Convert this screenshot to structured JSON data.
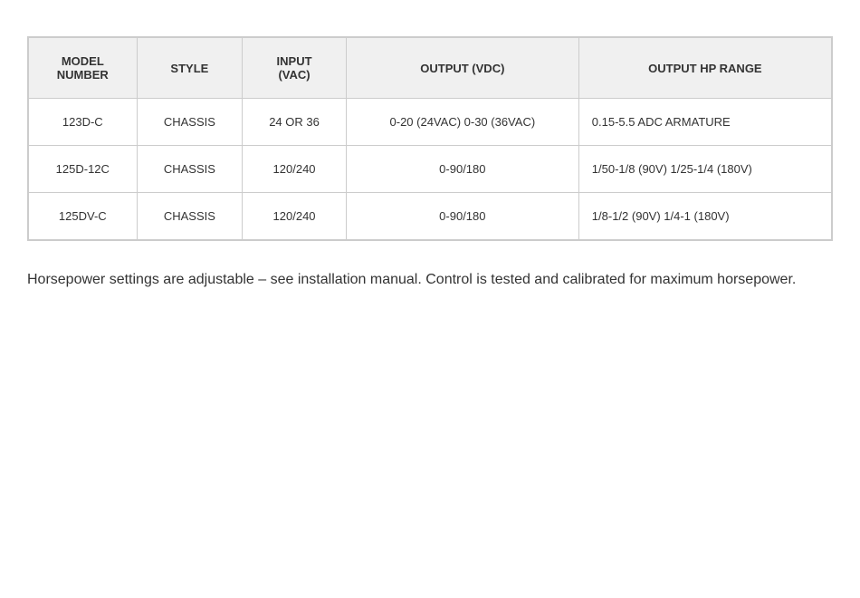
{
  "table": {
    "headers": [
      {
        "id": "model-number",
        "label": "MODEL\nNUMBER"
      },
      {
        "id": "style",
        "label": "STYLE"
      },
      {
        "id": "input-vac",
        "label": "INPUT\n(VAC)"
      },
      {
        "id": "output-vdc",
        "label": "OUTPUT (VDC)"
      },
      {
        "id": "output-hp-range",
        "label": "OUTPUT HP RANGE"
      }
    ],
    "rows": [
      {
        "model": "123D-C",
        "style": "CHASSIS",
        "input": "24 OR 36",
        "output_vdc": "0-20 (24VAC) 0-30 (36VAC)",
        "output_hp": "0.15-5.5 ADC ARMATURE"
      },
      {
        "model": "125D-12C",
        "style": "CHASSIS",
        "input": "120/240",
        "output_vdc": "0-90/180",
        "output_hp": "1/50-1/8 (90V) 1/25-1/4 (180V)"
      },
      {
        "model": "125DV-C",
        "style": "CHASSIS",
        "input": "120/240",
        "output_vdc": "0-90/180",
        "output_hp": "1/8-1/2 (90V) 1/4-1 (180V)"
      }
    ]
  },
  "footer": {
    "text": "Horsepower settings are adjustable – see installation manual. Control is tested and calibrated for maximum horsepower."
  }
}
